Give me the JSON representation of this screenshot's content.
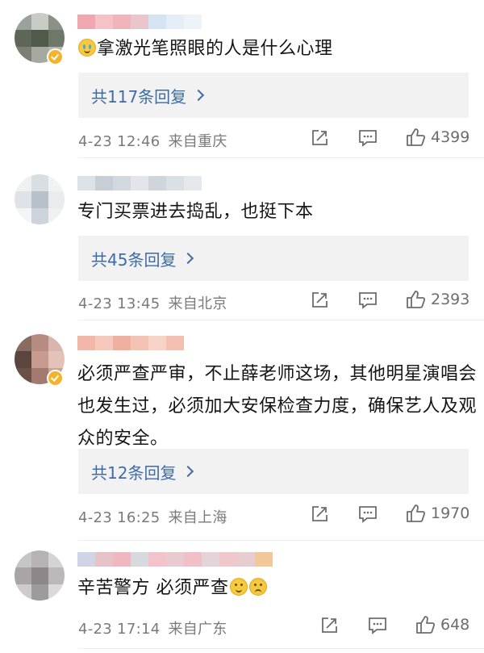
{
  "comments": [
    {
      "text_before": "",
      "text": "拿激光笔照眼的人是什么心理",
      "emoji_prefix": true,
      "replies_label": "共117条回复",
      "time": "4-23 12:46",
      "location": "来自重庆",
      "likes": "4399",
      "badge": true
    },
    {
      "text": "专门买票进去捣乱，也挺下本",
      "replies_label": "共45条回复",
      "time": "4-23 13:45",
      "location": "来自北京",
      "likes": "2393",
      "badge": false
    },
    {
      "text": "必须严查严审，不止薛老师这场，其他明星演唱会也发生过，必须加大安保检查力度，确保艺人及观众的安全。",
      "replies_label": "共12条回复",
      "time": "4-23 16:25",
      "location": "来自上海",
      "likes": "1970",
      "badge": true
    },
    {
      "text": "辛苦警方 必须严查",
      "emoji_suffix": true,
      "time": "4-23 17:14",
      "location": "来自广东",
      "likes": "648",
      "badge": false
    }
  ],
  "icons": {
    "share": "share-icon",
    "comment": "comment-icon",
    "like": "like-icon"
  },
  "colors": {
    "reply_link": "#3f6ca5",
    "meta": "#7a7a7a",
    "reply_bg": "#f2f2f2"
  }
}
